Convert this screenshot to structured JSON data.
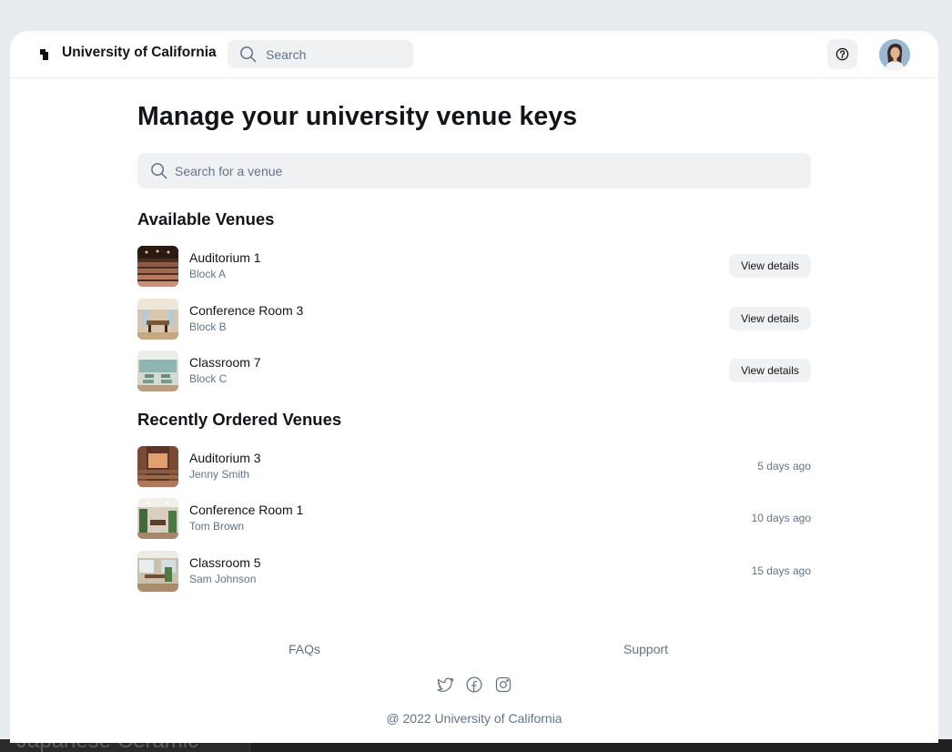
{
  "header": {
    "brand": "University of California",
    "search_placeholder": "Search"
  },
  "main": {
    "title": "Manage your university venue keys",
    "venue_search_placeholder": "Search for a venue",
    "available": {
      "title": "Available Venues",
      "button_label": "View details",
      "items": [
        {
          "name": "Auditorium 1",
          "block": "Block A"
        },
        {
          "name": "Conference Room 3",
          "block": "Block B"
        },
        {
          "name": "Classroom 7",
          "block": "Block C"
        }
      ]
    },
    "recent": {
      "title": "Recently Ordered Venues",
      "items": [
        {
          "name": "Auditorium 3",
          "person": "Jenny Smith",
          "time": "5 days ago"
        },
        {
          "name": "Conference Room 1",
          "person": "Tom Brown",
          "time": "10 days ago"
        },
        {
          "name": "Classroom 5",
          "person": "Sam Johnson",
          "time": "15 days ago"
        }
      ]
    }
  },
  "footer": {
    "faqs": "FAQs",
    "support": "Support",
    "social": [
      "twitter-icon",
      "facebook-icon",
      "instagram-icon"
    ],
    "copyright": "@ 2022 University of California"
  },
  "background": {
    "partial_text": "Japanese Ceramic"
  },
  "colors": {
    "text_primary": "#121417",
    "text_secondary": "#637387",
    "surface_muted": "#eff1f3"
  }
}
